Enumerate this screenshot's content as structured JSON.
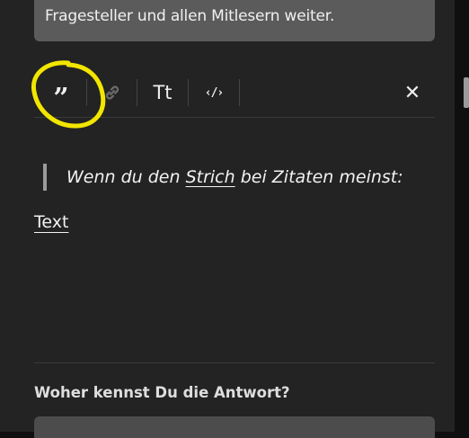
{
  "info_box": {
    "text": "Fragesteller und allen Mitlesern weiter."
  },
  "toolbar": {
    "quote_glyph": "”",
    "tt_label": "Tt",
    "code_label": "‹/›",
    "close_label": "✕"
  },
  "editor": {
    "quote_before": "Wenn du den ",
    "quote_link": "Strich",
    "quote_after": " bei Zitaten meinst:",
    "paragraph": "Text"
  },
  "question": {
    "label": "Woher kennst Du die Antwort?"
  },
  "icons": [
    "quote-icon",
    "link-icon",
    "text-format-icon",
    "code-icon",
    "close-icon"
  ],
  "colors": {
    "panel": "#232323",
    "highlight": "#f2e600",
    "info_box": "#5b5b5b"
  }
}
